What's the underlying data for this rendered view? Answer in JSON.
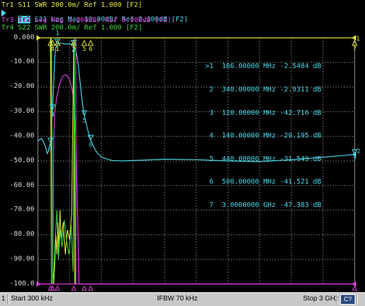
{
  "traces": [
    {
      "text": "Tr1 S11 SWR 200.0m/ Ref 1.000 [F2]",
      "color": "#e8e840"
    },
    {
      "tag": "Tr2",
      "text": " S21 Log Mag 10.00dB/ Ref 0.000dB [F2]",
      "color": "#48d8e8"
    },
    {
      "text": "Tr3 S12 Log Mag 1.000dB/ Ref 0.000dB [F2]",
      "color": "#e040e0"
    },
    {
      "text": "Tr4 S22 SWR 200.0m/ Ref 1.000 [F2]",
      "color": "#40d840"
    }
  ],
  "y_ticks": [
    "0.000",
    "-10.00",
    "-20.00",
    "-30.00",
    "-40.00",
    "-50.00",
    "-60.00",
    "-70.00",
    "-80.00",
    "-90.00",
    "-100.0"
  ],
  "marker_rows": [
    ">1  186.00000 MHz -2.5484 dB",
    " 2  340.00000 MHz -2.9311 dB",
    " 3  120.00000 MHz -42.716 dB",
    " 4  140.00000 MHz -29.195 dB",
    " 5  440.00000 MHz -31.549 dB",
    " 6  500.00000 MHz -41.521 dB",
    " 7  3.0000000 GHz -47.383 dB"
  ],
  "status": {
    "channel": "1",
    "start": "Start 300 kHz",
    "ifbw": "IFBW 70 kHz",
    "stop": "Stop 3 GHz",
    "cal": "C?"
  },
  "colors": {
    "grid": "#6a6a6a",
    "s11": "#e8e840",
    "s21": "#48d8e8",
    "s12": "#e040e0",
    "s22": "#40d840",
    "ref": "#e8e840"
  },
  "chart_data": {
    "type": "line",
    "x_range_mhz": [
      0.3,
      3000
    ],
    "ylim": [
      -100,
      0
    ],
    "grid": true,
    "series": [
      {
        "name": "S21",
        "x_mhz": [
          0.3,
          10,
          30,
          50,
          70,
          90,
          100,
          110,
          120,
          130,
          140,
          150,
          160,
          170,
          186,
          200,
          230,
          260,
          300,
          340,
          360,
          380,
          400,
          420,
          440,
          470,
          500,
          550,
          600,
          700,
          800,
          1000,
          1200,
          1500,
          1800,
          2100,
          2400,
          2700,
          3000
        ],
        "y_db": [
          -42,
          -41.5,
          -41,
          -42,
          -44,
          -47,
          -46,
          -44,
          -42.7,
          -36,
          -29.2,
          -18,
          -8,
          -4,
          -2.55,
          -2.2,
          -2.3,
          -2.5,
          -2.4,
          -2.93,
          -5,
          -10,
          -18,
          -26,
          -31.5,
          -37,
          -41.5,
          -46,
          -48.5,
          -49.8,
          -50,
          -49.7,
          -49.3,
          -49.5,
          -50,
          -50.3,
          -49.5,
          -48.5,
          -47.4
        ]
      },
      {
        "name": "S12",
        "x_mhz": [
          0.3,
          120,
          140,
          150,
          160,
          180,
          200,
          220,
          240,
          260,
          280,
          300,
          320,
          340,
          360,
          390,
          420,
          3000
        ],
        "y_db": [
          -100,
          -100,
          -100,
          -40,
          -30,
          -24,
          -20,
          -17,
          -15.5,
          -15,
          -15.5,
          -17,
          -20,
          -25,
          -40,
          -100,
          -100,
          -100
        ]
      }
    ],
    "markers": [
      {
        "id": "1",
        "x_mhz": 186,
        "y_db": -2.5484
      },
      {
        "id": "2",
        "x_mhz": 340,
        "y_db": -2.9311
      },
      {
        "id": "3",
        "x_mhz": 120,
        "y_db": -42.716
      },
      {
        "id": "4",
        "x_mhz": 140,
        "y_db": -29.195
      },
      {
        "id": "5",
        "x_mhz": 440,
        "y_db": -31.549
      },
      {
        "id": "6",
        "x_mhz": 500,
        "y_db": -41.521
      },
      {
        "id": "7",
        "x_mhz": 3000,
        "y_db": -47.383
      }
    ]
  }
}
